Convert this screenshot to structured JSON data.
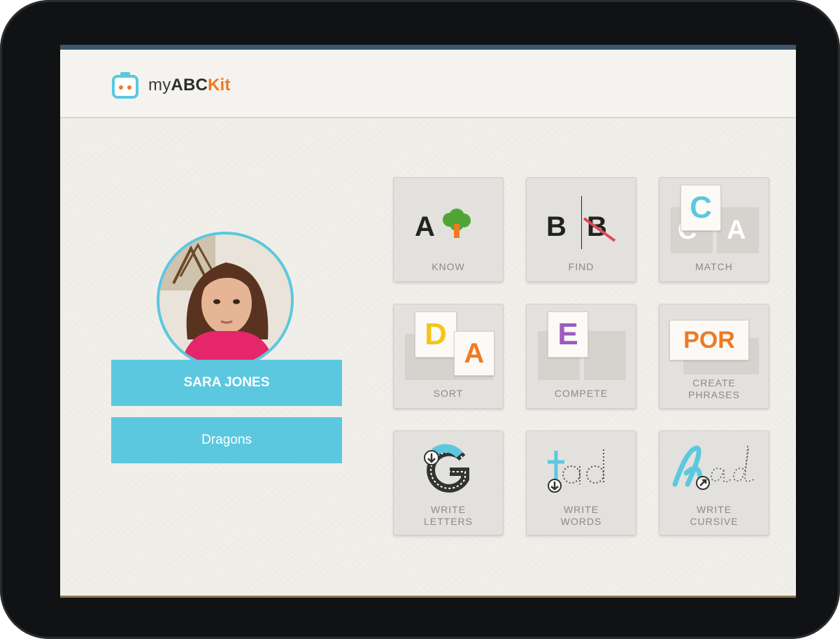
{
  "app": {
    "logo_prefix": "my",
    "logo_abc": "ABC",
    "logo_kit": "Kit"
  },
  "profile": {
    "name": "SARA JONES",
    "team": "Dragons"
  },
  "activities": [
    {
      "id": "know",
      "label": "KNOW",
      "icon": "letter-a-tree",
      "letters": [
        "A"
      ]
    },
    {
      "id": "find",
      "label": "FIND",
      "icon": "letter-b-crossed",
      "letters": [
        "B",
        "B"
      ]
    },
    {
      "id": "match",
      "label": "MATCH",
      "icon": "match-cards",
      "letters": [
        "C",
        "A"
      ]
    },
    {
      "id": "sort",
      "label": "SORT",
      "icon": "sort-cards",
      "letters": [
        "D",
        "A"
      ]
    },
    {
      "id": "compete",
      "label": "COMPETE",
      "icon": "compete-card",
      "letters": [
        "E"
      ]
    },
    {
      "id": "create_phrases",
      "label_line1": "CREATE",
      "label_line2": "PHRASES",
      "icon": "phrase-card",
      "letters": [
        "POR"
      ]
    },
    {
      "id": "write_letters",
      "label_line1": "WRITE",
      "label_line2": "LETTERS",
      "icon": "trace-g",
      "letters": [
        "G"
      ]
    },
    {
      "id": "write_words",
      "label_line1": "WRITE",
      "label_line2": "WORDS",
      "icon": "trace-word",
      "letters": [
        "tad"
      ]
    },
    {
      "id": "write_cursive",
      "label_line1": "WRITE",
      "label_line2": "CURSIVE",
      "icon": "trace-cursive",
      "letters": [
        "had"
      ]
    }
  ],
  "colors": {
    "accent": "#5cc8df",
    "orange": "#ef7a22",
    "yellow": "#f5c518",
    "purple": "#9b5bbf",
    "tree_green": "#4fa636",
    "red_cross": "#e04858"
  }
}
